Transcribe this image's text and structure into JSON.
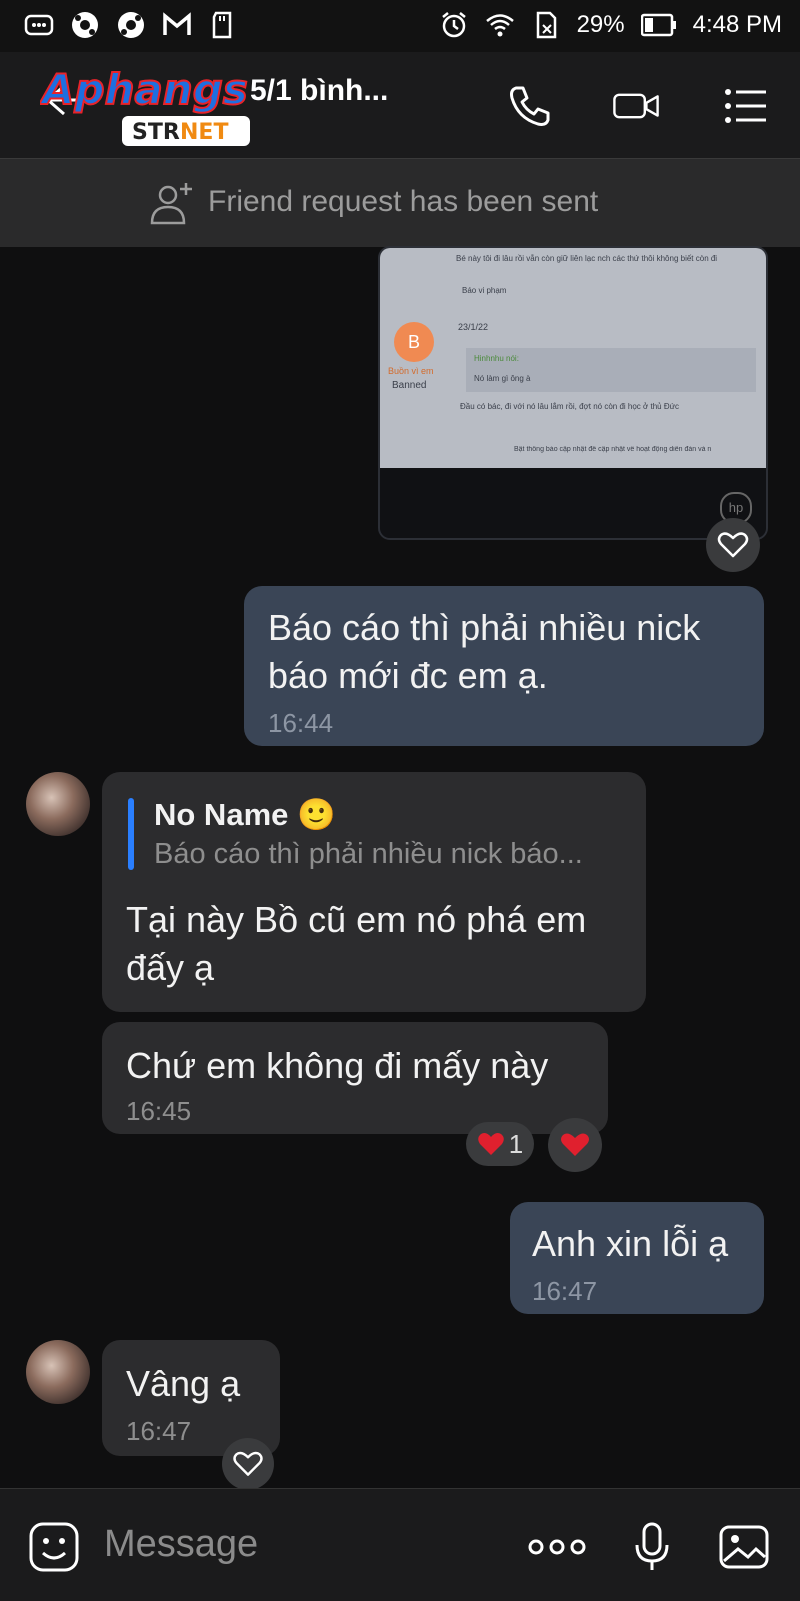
{
  "status_bar": {
    "battery": "29%",
    "time": "4:48 PM"
  },
  "header": {
    "title": "5/1 bình...",
    "logo_text": "Aphangs",
    "logo_sub": "STRNET"
  },
  "banner": {
    "text": "Friend request has been sent"
  },
  "photo": {
    "line1": "Bé này tôi đi lâu rồi vẫn còn giữ liên lạc nch các thứ thôi không biết còn đi",
    "report": "Báo vi phạm",
    "date": "23/1/22",
    "avatar_letter": "B",
    "user": "Buồn vì em",
    "user_status": "Banned",
    "quote_name": "Hinhnhu nói:",
    "quote_text": "Nó làm gì ông à",
    "line3": "Đầu có bác, đi với nó lâu lắm rồi, đợt nó còn đi học ở thủ Đức",
    "footer": "Bật thông báo cập nhật để cập nhật về hoạt động diễn đàn và n"
  },
  "messages": [
    {
      "text": "Báo cáo thì phải nhiều nick báo mới đc em ạ.",
      "time": "16:44"
    },
    {
      "quote_name": "No Name 🙂",
      "quote_text": "Báo cáo thì phải nhiều nick báo...",
      "text": "Tại này Bồ cũ em nó phá em đấy ạ"
    },
    {
      "text": "Chứ em không đi mấy này",
      "time": "16:45",
      "reaction_count": "1"
    },
    {
      "text": "Anh xin lỗi ạ",
      "time": "16:47"
    },
    {
      "text": "Vâng ạ",
      "time": "16:47"
    }
  ],
  "composer": {
    "placeholder": "Message"
  }
}
